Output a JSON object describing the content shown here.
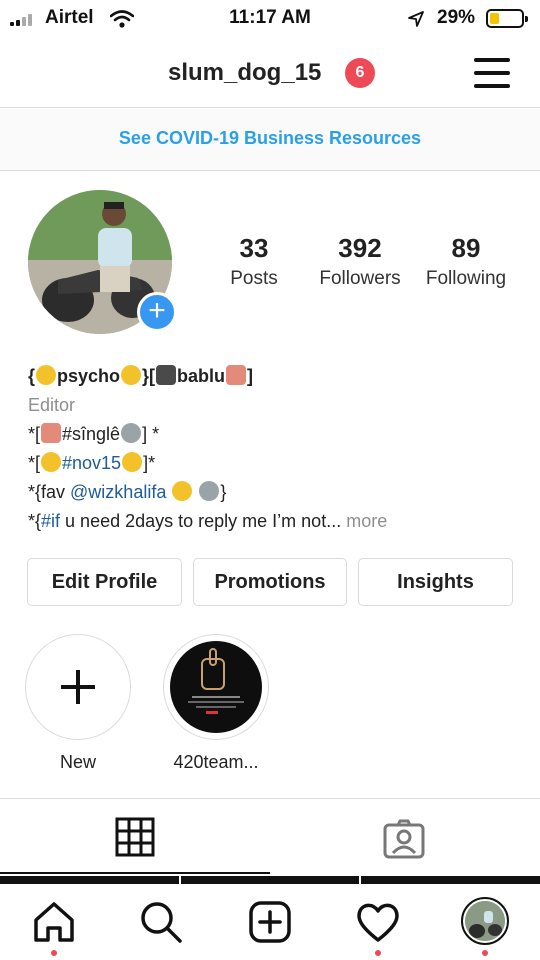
{
  "status_bar": {
    "carrier": "Airtel",
    "time": "11:17 AM",
    "battery_pct": "29%",
    "battery_level": 0.29
  },
  "header": {
    "username": "slum_dog_15",
    "notification_count": "6",
    "menu_icon": "hamburger-menu-icon"
  },
  "banner": {
    "text": "See COVID-19 Business Resources"
  },
  "profile": {
    "stats": [
      {
        "value": "33",
        "label": "Posts"
      },
      {
        "value": "392",
        "label": "Followers"
      },
      {
        "value": "89",
        "label": "Following"
      }
    ],
    "add_story_icon": "plus-icon"
  },
  "bio": {
    "name_parts": [
      "{",
      "psycho",
      "}[",
      "bablu",
      "]"
    ],
    "category": "Editor",
    "line1": {
      "prefix": "*[",
      "tag": "#sînglê",
      "suffix": "] *"
    },
    "line2": {
      "prefix": "*[",
      "tag": "#nov15",
      "suffix": "]*"
    },
    "line3": {
      "prefix": "*{fav ",
      "mention": "@wizkhalifa",
      "suffix": "}"
    },
    "line4": {
      "prefix": "*{",
      "tag": "#if",
      "text": " u need 2days to reply me I’m not...",
      "more": " more"
    }
  },
  "actions": {
    "edit_profile": "Edit Profile",
    "promotions": "Promotions",
    "insights": "Insights"
  },
  "highlights": [
    {
      "label": "New",
      "icon": "plus-icon"
    },
    {
      "label": "420team..."
    }
  ],
  "tabs": [
    {
      "name": "grid",
      "icon": "grid-icon",
      "active": true
    },
    {
      "name": "tagged",
      "icon": "tagged-person-icon",
      "active": false
    }
  ],
  "bottom_nav": [
    {
      "name": "home",
      "icon": "home-icon",
      "notification_dot": true
    },
    {
      "name": "search",
      "icon": "search-icon",
      "notification_dot": false
    },
    {
      "name": "new-post",
      "icon": "add-post-icon",
      "notification_dot": false
    },
    {
      "name": "activity",
      "icon": "heart-icon",
      "notification_dot": true
    },
    {
      "name": "profile",
      "icon": "profile-avatar",
      "notification_dot": true
    }
  ],
  "colors": {
    "link_blue": "#2aa0e8",
    "badge_red": "#ed4956",
    "story_blue": "#3897f0",
    "mention_blue": "#1e5c9b"
  }
}
